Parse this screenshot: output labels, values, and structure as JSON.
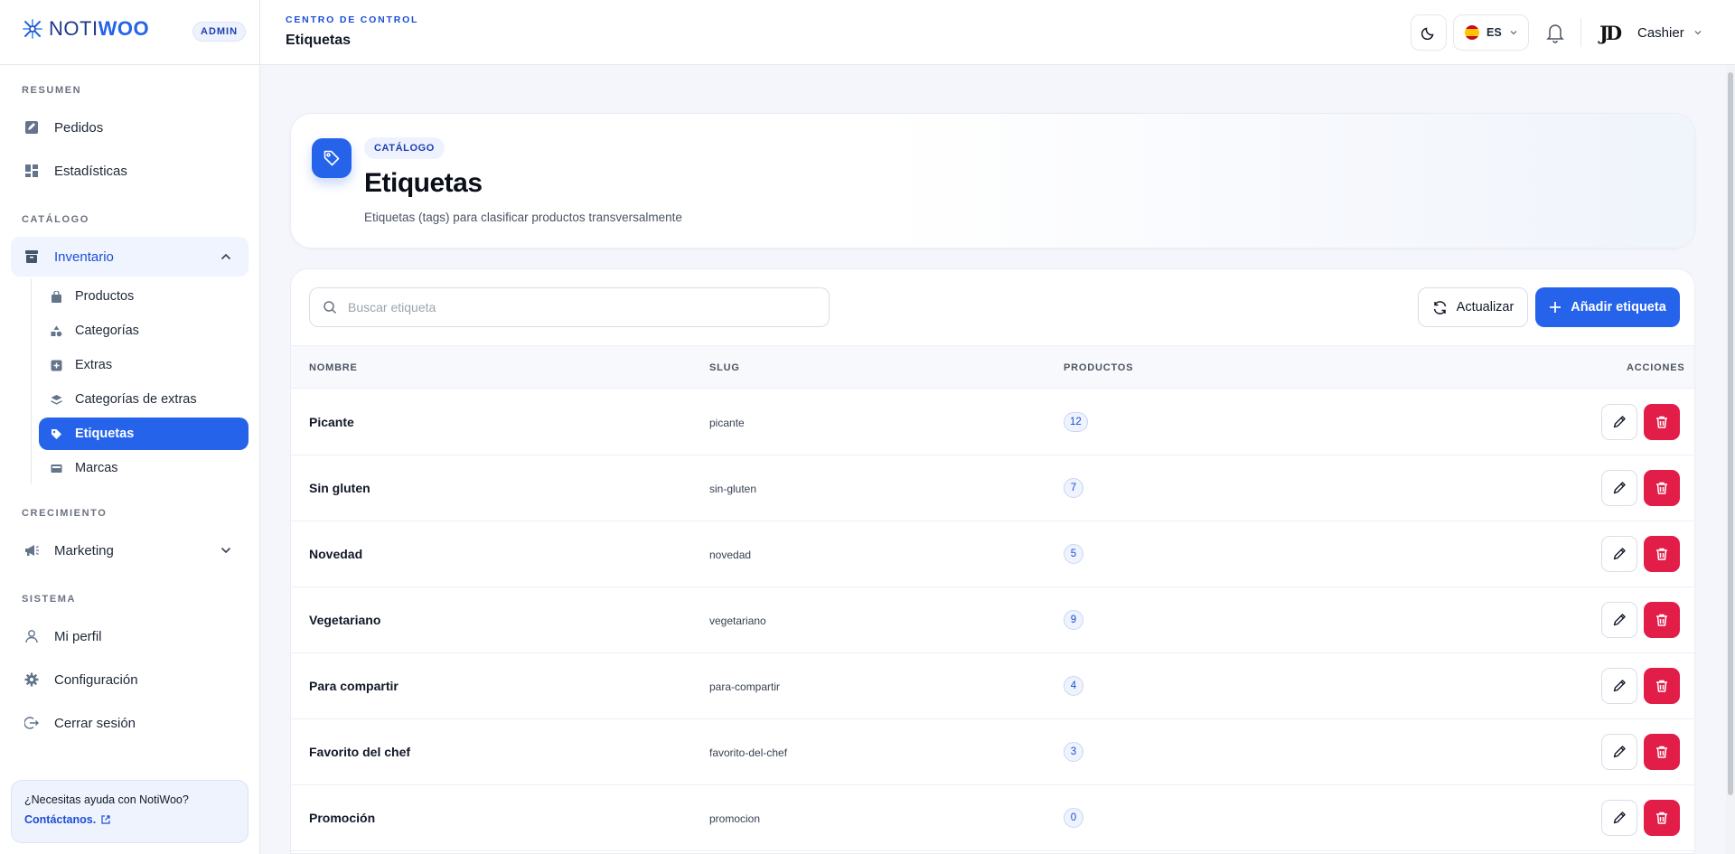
{
  "brand": {
    "name_light": "NOTI",
    "name_bold": "WOO",
    "badge": "ADMIN"
  },
  "sidebar": {
    "sections": {
      "resumen": "RESUMEN",
      "catalogo": "CATÁLOGO",
      "crecimiento": "CRECIMIENTO",
      "sistema": "SISTEMA"
    },
    "items": {
      "pedidos": "Pedidos",
      "estadisticas": "Estadísticas",
      "inventario": "Inventario",
      "marketing": "Marketing",
      "perfil": "Mi perfil",
      "configuracion": "Configuración",
      "logout": "Cerrar sesión"
    },
    "inventory_sub": {
      "productos": "Productos",
      "categorias": "Categorías",
      "extras": "Extras",
      "categorias_extras": "Categorías de extras",
      "etiquetas": "Etiquetas",
      "marcas": "Marcas"
    },
    "help": {
      "title": "¿Necesitas ayuda con NotiWoo?",
      "link": "Contáctanos."
    }
  },
  "topbar": {
    "kicker": "CENTRO DE CONTROL",
    "title": "Etiquetas",
    "language": "ES",
    "user_initials": "JD",
    "user_name": "Cashier"
  },
  "hero": {
    "chip": "CATÁLOGO",
    "title": "Etiquetas",
    "subtitle": "Etiquetas (tags) para clasificar productos transversalmente"
  },
  "toolbar": {
    "search_placeholder": "Buscar etiqueta",
    "refresh_label": "Actualizar",
    "add_label": "Añadir etiqueta"
  },
  "table": {
    "headers": {
      "name": "NOMBRE",
      "slug": "SLUG",
      "products": "PRODUCTOS",
      "actions": "ACCIONES"
    },
    "rows": [
      {
        "name": "Picante",
        "slug": "picante",
        "count": "12"
      },
      {
        "name": "Sin gluten",
        "slug": "sin-gluten",
        "count": "7"
      },
      {
        "name": "Novedad",
        "slug": "novedad",
        "count": "5"
      },
      {
        "name": "Vegetariano",
        "slug": "vegetariano",
        "count": "9"
      },
      {
        "name": "Para compartir",
        "slug": "para-compartir",
        "count": "4"
      },
      {
        "name": "Favorito del chef",
        "slug": "favorito-del-chef",
        "count": "3"
      },
      {
        "name": "Promoción",
        "slug": "promocion",
        "count": "0"
      }
    ]
  },
  "colors": {
    "accent": "#2563eb",
    "danger": "#e11d48"
  }
}
